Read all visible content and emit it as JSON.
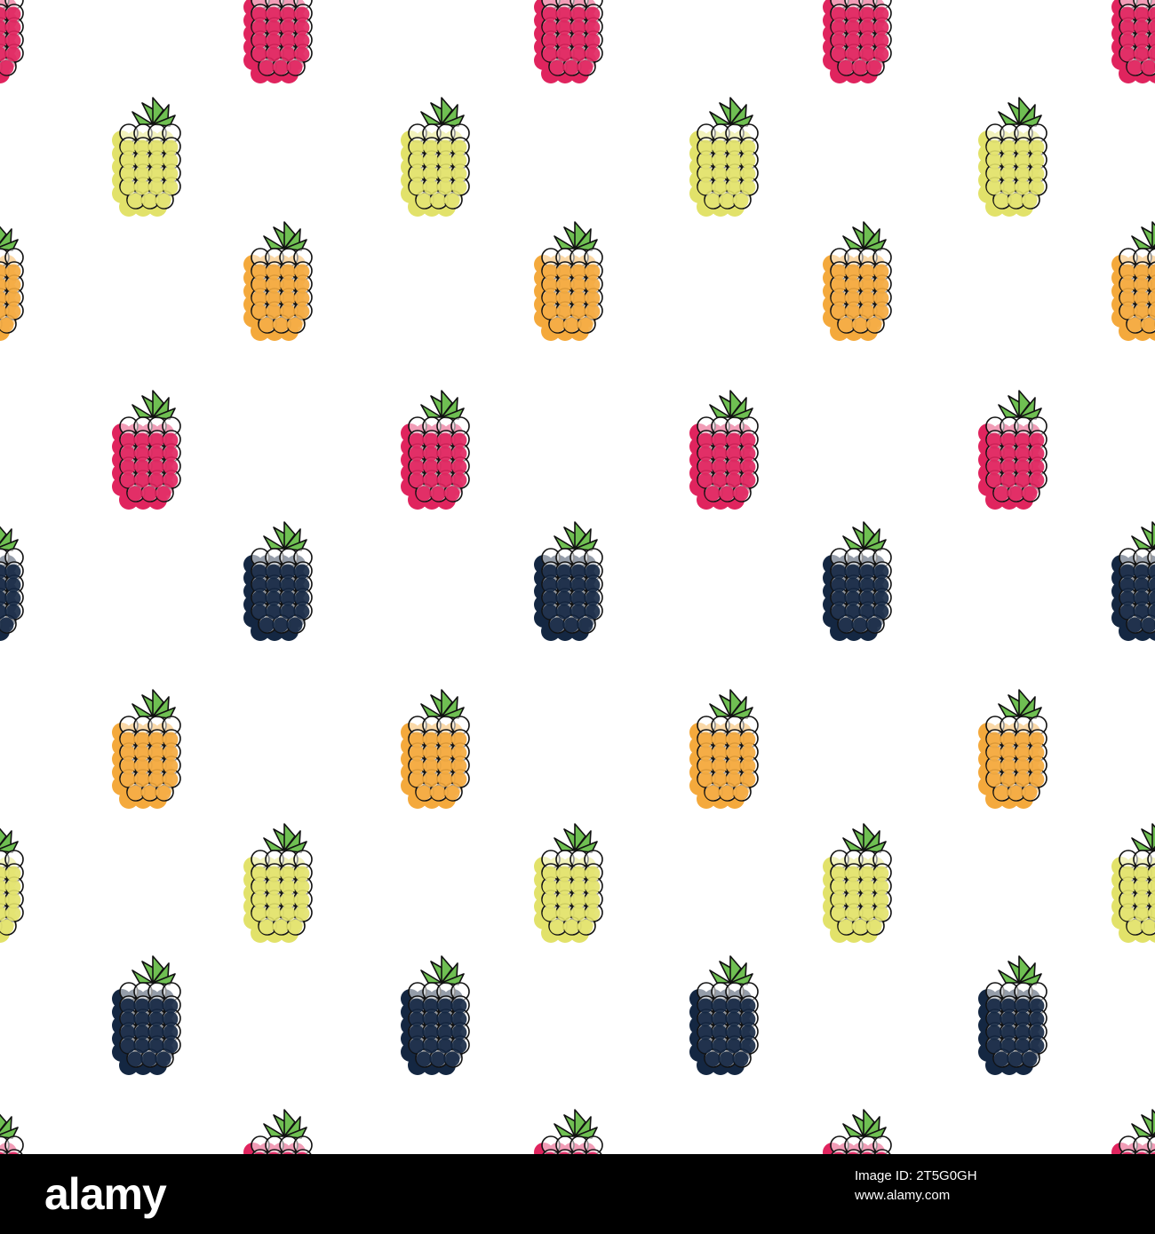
{
  "pattern": {
    "background": "#ffffff",
    "outline_color": "#111111",
    "leaf_color": "#6fbf52",
    "berry_colors": {
      "pink": "#e0245e",
      "yellow": "#e2e26a",
      "orange": "#f4a93c",
      "navy": "#142742"
    },
    "icon_name": "raspberry-icon",
    "rows": [
      [
        "pink",
        "pink",
        "pink",
        "pink",
        "pink"
      ],
      [
        "yellow",
        "yellow",
        "yellow",
        "yellow"
      ],
      [
        "orange",
        "orange",
        "orange",
        "orange",
        "orange"
      ],
      [
        "pink",
        "pink",
        "pink",
        "pink"
      ],
      [
        "navy",
        "navy",
        "navy",
        "navy",
        "navy"
      ],
      [
        "orange",
        "orange",
        "orange",
        "orange"
      ],
      [
        "yellow",
        "yellow",
        "yellow",
        "yellow",
        "yellow"
      ],
      [
        "navy",
        "navy",
        "navy",
        "navy"
      ],
      [
        "pink",
        "pink",
        "pink",
        "pink",
        "pink"
      ]
    ]
  },
  "watermark": {
    "brand": "alamy",
    "image_id_line": "Image ID: 2T5G0GH",
    "site_line": "www.alamy.com"
  }
}
